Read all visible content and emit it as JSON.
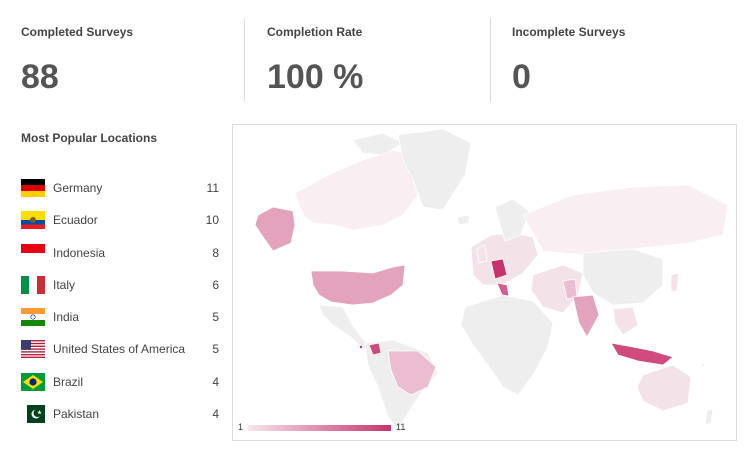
{
  "stats": [
    {
      "label": "Completed Surveys",
      "value": "88"
    },
    {
      "label": "Completion Rate",
      "value": "100 %"
    },
    {
      "label": "Incomplete Surveys",
      "value": "0"
    }
  ],
  "locations": {
    "title": "Most Popular Locations",
    "items": [
      {
        "name": "Germany",
        "count": "11",
        "flag": "germany-flag-icon"
      },
      {
        "name": "Ecuador",
        "count": "10",
        "flag": "ecuador-flag-icon"
      },
      {
        "name": "Indonesia",
        "count": "8",
        "flag": "indonesia-flag-icon"
      },
      {
        "name": "Italy",
        "count": "6",
        "flag": "italy-flag-icon"
      },
      {
        "name": "India",
        "count": "5",
        "flag": "india-flag-icon"
      },
      {
        "name": "United States of America",
        "count": "5",
        "flag": "usa-flag-icon"
      },
      {
        "name": "Brazil",
        "count": "4",
        "flag": "brazil-flag-icon"
      },
      {
        "name": "Pakistan",
        "count": "4",
        "flag": "pakistan-flag-icon"
      }
    ]
  },
  "map": {
    "legend_min": "1",
    "legend_max": "11",
    "colors": {
      "low": "#f6e6ec",
      "high": "#c8336d",
      "base": "#eeeeee",
      "border": "#ffffff"
    }
  }
}
